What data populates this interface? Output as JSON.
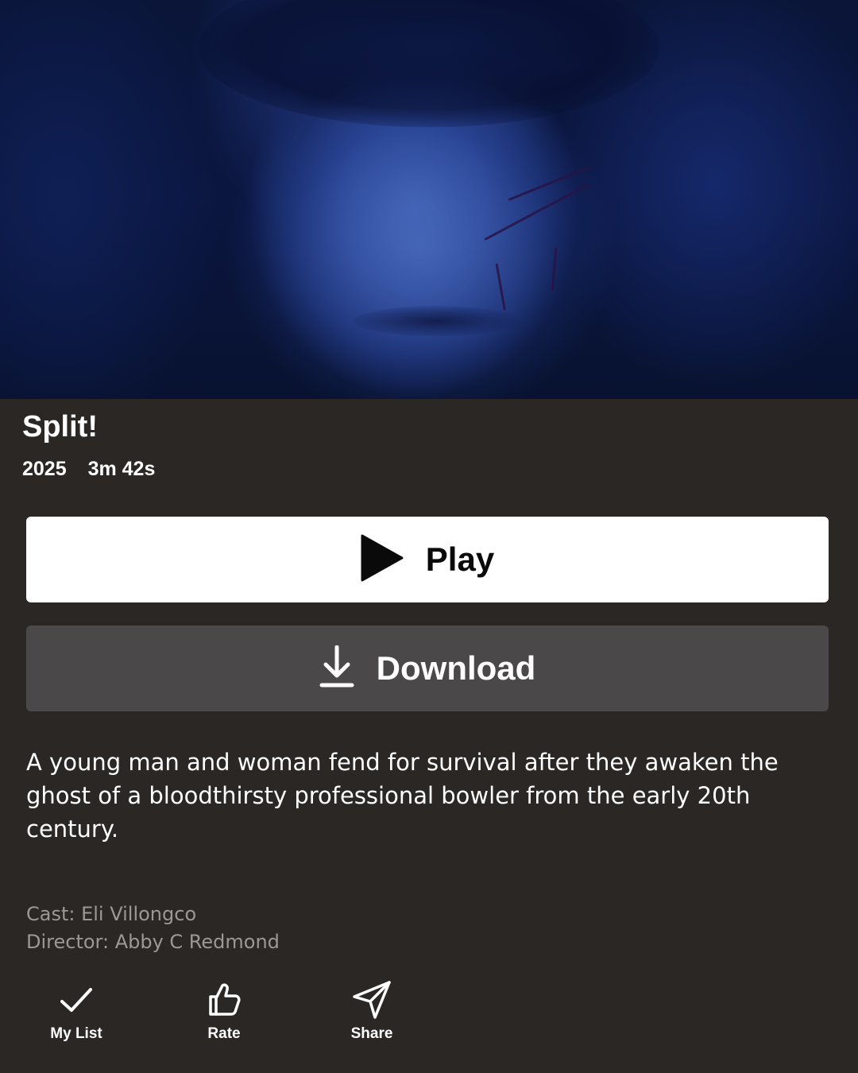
{
  "hero": {
    "alt": "Close-up of a young man's face lit in blue with scratch marks on his cheek"
  },
  "title": "Split!",
  "meta": {
    "year": "2025",
    "duration": "3m 42s"
  },
  "buttons": {
    "play_label": "Play",
    "download_label": "Download"
  },
  "description": "A young man and woman fend for survival after they awaken the ghost of a bloodthirsty professional bowler from the early 20th century.",
  "credits": {
    "cast": "Cast: Eli Villongco",
    "director": "Director: Abby C Redmond"
  },
  "actions": [
    {
      "label": "My List",
      "icon": "check-icon"
    },
    {
      "label": "Rate",
      "icon": "thumbs-up-icon"
    },
    {
      "label": "Share",
      "icon": "send-icon"
    }
  ],
  "colors": {
    "background": "#2a2725",
    "play_button": "#ffffff",
    "download_button": "#4a4848",
    "credits_text": "#9b9895",
    "hero_tint": "#2b4592"
  }
}
